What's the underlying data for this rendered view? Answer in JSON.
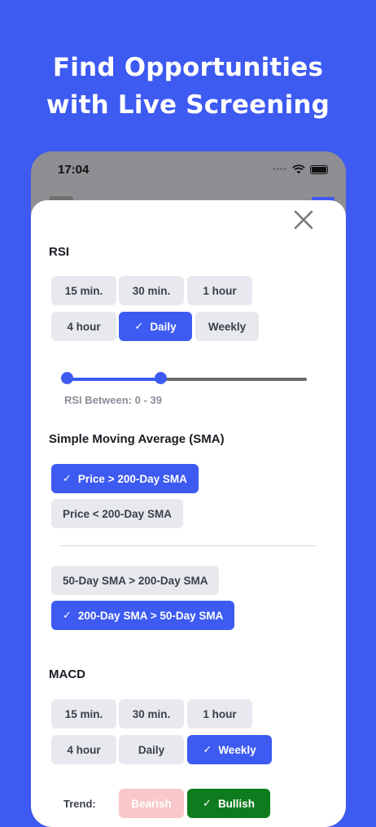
{
  "promo": {
    "line1": "Find Opportunities",
    "line2": "with Live Screening"
  },
  "status_bar": {
    "time": "17:04"
  },
  "colors": {
    "accent": "#3D5AF1",
    "chip_bg": "#E8E9EE",
    "bearish": "#F9C7C9",
    "bullish": "#0E7C1E"
  },
  "rsi": {
    "title": "RSI",
    "timeframes": [
      {
        "label": "15 min.",
        "selected": false
      },
      {
        "label": "30 min.",
        "selected": false
      },
      {
        "label": "1 hour",
        "selected": false
      },
      {
        "label": "4 hour",
        "selected": false
      },
      {
        "label": "Daily",
        "selected": true
      },
      {
        "label": "Weekly",
        "selected": false
      }
    ],
    "range_min": 0,
    "range_max": 39,
    "caption": "RSI Between: 0 - 39"
  },
  "sma": {
    "title": "Simple Moving Average (SMA)",
    "group1": [
      {
        "label": "Price > 200-Day SMA",
        "selected": true
      },
      {
        "label": "Price < 200-Day SMA",
        "selected": false
      }
    ],
    "group2": [
      {
        "label": "50-Day SMA > 200-Day SMA",
        "selected": false
      },
      {
        "label": "200-Day SMA > 50-Day SMA",
        "selected": true
      }
    ]
  },
  "macd": {
    "title": "MACD",
    "timeframes": [
      {
        "label": "15 min.",
        "selected": false
      },
      {
        "label": "30 min.",
        "selected": false
      },
      {
        "label": "1 hour",
        "selected": false
      },
      {
        "label": "4 hour",
        "selected": false
      },
      {
        "label": "Daily",
        "selected": false
      },
      {
        "label": "Weekly",
        "selected": true
      }
    ],
    "trend_label": "Trend:",
    "trend": [
      {
        "label": "Bearish",
        "selected": false
      },
      {
        "label": "Bullish",
        "selected": true
      }
    ]
  },
  "icons": {
    "close": "close-icon",
    "check": "check-icon",
    "wifi": "wifi-icon",
    "battery": "battery-icon"
  }
}
